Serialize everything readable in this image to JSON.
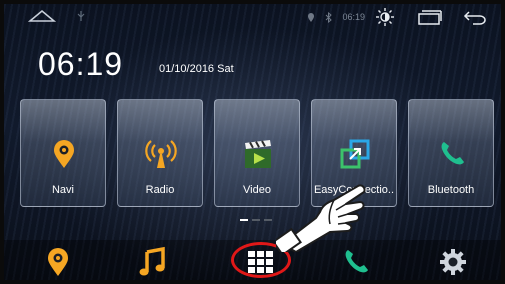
{
  "statusbar": {
    "time": "06:19",
    "icons": [
      "home-icon",
      "usb-icon",
      "location-icon",
      "bluetooth-icon",
      "brightness-icon",
      "recent-apps-icon",
      "back-icon"
    ]
  },
  "clock": {
    "time": "06:19",
    "date": "01/10/2016 Sat"
  },
  "tiles": [
    {
      "label": "Navi",
      "icon": "navigation-pin-icon"
    },
    {
      "label": "Radio",
      "icon": "radio-antenna-icon"
    },
    {
      "label": "Video",
      "icon": "video-clapper-icon"
    },
    {
      "label": "EasyConnectio..",
      "icon": "easy-connection-icon"
    },
    {
      "label": "Bluetooth",
      "icon": "phone-icon"
    }
  ],
  "page_indicator": {
    "pages": 3,
    "current": 1
  },
  "dock": {
    "items": [
      "navigation-pin-icon",
      "music-icon",
      "apps-grid-icon",
      "phone-icon",
      "settings-gear-icon"
    ]
  },
  "colors": {
    "accent_orange": "#f5a623",
    "phone_green": "#1fbf8f",
    "highlight_ring": "#e01818"
  }
}
